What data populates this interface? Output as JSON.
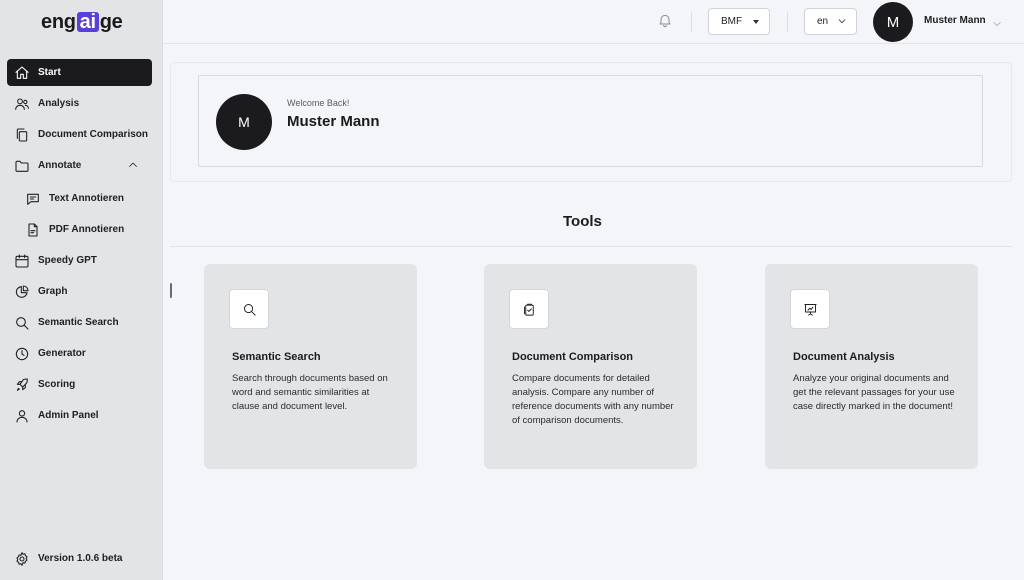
{
  "brand": {
    "logo_pre": "eng",
    "logo_ai": "ai",
    "logo_post": "ge",
    "accent": "#5b3fd9"
  },
  "sidebar": {
    "items": [
      {
        "label": "Start",
        "icon": "home-icon",
        "active": true
      },
      {
        "label": "Analysis",
        "icon": "users-icon"
      },
      {
        "label": "Document Comparison",
        "icon": "copy-icon"
      },
      {
        "label": "Annotate",
        "icon": "folder-icon"
      },
      {
        "label": "Text Annotieren",
        "icon": "message-icon"
      },
      {
        "label": "PDF Annotieren",
        "icon": "file-icon"
      },
      {
        "label": "Speedy GPT",
        "icon": "calendar-icon"
      },
      {
        "label": "Graph",
        "icon": "pie-icon"
      },
      {
        "label": "Semantic Search",
        "icon": "search-icon"
      },
      {
        "label": "Generator",
        "icon": "clock-icon"
      },
      {
        "label": "Scoring",
        "icon": "rocket-icon"
      },
      {
        "label": "Admin Panel",
        "icon": "user-icon"
      }
    ],
    "version": "Version 1.0.6 beta"
  },
  "topbar": {
    "org_select": "BMF",
    "lang_select": "en",
    "avatar_initial": "M",
    "user_name": "Muster Mann"
  },
  "welcome": {
    "avatar_initial": "M",
    "greeting": "Welcome Back!",
    "name": "Muster Mann"
  },
  "tools": {
    "title": "Tools",
    "cards": [
      {
        "title": "Semantic Search",
        "icon": "search-icon",
        "description": "Search through documents based on word and semantic similarities at clause and document level."
      },
      {
        "title": "Document Comparison",
        "icon": "clipboard-check-icon",
        "description": "Compare documents for detailed analysis. Compare any number of reference documents with any number of comparison documents."
      },
      {
        "title": "Document Analysis",
        "icon": "presentation-chart-icon",
        "description": "Analyze your original documents and get the relevant passages for your use case directly marked in the document!"
      }
    ]
  }
}
